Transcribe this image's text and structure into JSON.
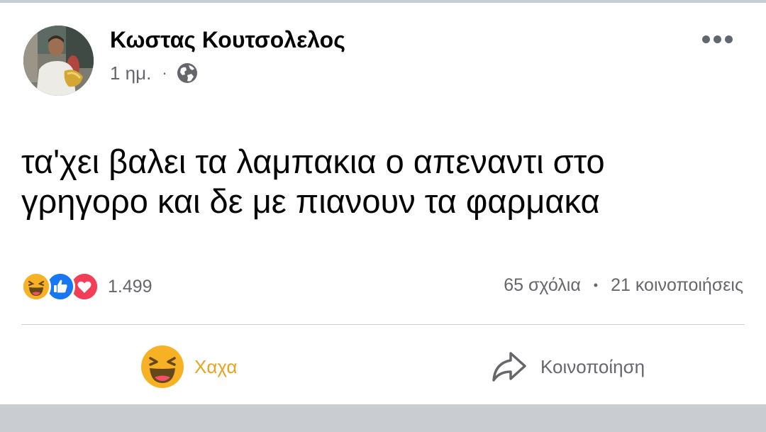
{
  "post": {
    "author": "Κωστας Κουτσολελος",
    "time": "1 ημ.",
    "separator": "·",
    "audience_icon": "globe-icon",
    "text_lines": [
      "τα'χει βαλει τα λαμπακια ο απεναντι στο",
      "γρηγορο και δε με πιανουν τα φαρμακα"
    ]
  },
  "reactions": {
    "icons": [
      "haha-icon",
      "like-icon",
      "love-icon"
    ],
    "count": "1.499"
  },
  "stats": {
    "comments": "65 σχόλια",
    "separator": "•",
    "shares": "21 κοινοποιήσεις"
  },
  "actions": {
    "reaction_label": "Χαχα",
    "share_label": "Κοινοποίηση"
  },
  "colors": {
    "haha_yellow": "#f7b125",
    "haha_label": "#e4a520",
    "like_blue": "#1877f2",
    "love_red": "#f33e58",
    "secondary_text": "#65676b",
    "frame_gray": "#c9ccd1"
  }
}
